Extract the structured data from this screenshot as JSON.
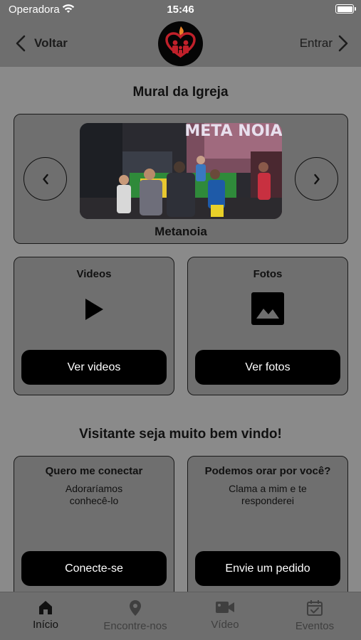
{
  "status_bar": {
    "carrier": "Operadora",
    "time": "15:46"
  },
  "nav": {
    "back_label": "Voltar",
    "login_label": "Entrar"
  },
  "mural": {
    "title": "Mural da Igreja",
    "caption": "Metanoia",
    "photo_banner_text": "META NOIA"
  },
  "videos_card": {
    "title": "Videos",
    "button": "Ver videos"
  },
  "photos_card": {
    "title": "Fotos",
    "button": "Ver fotos"
  },
  "welcome": {
    "title": "Visitante seja muito bem vindo!"
  },
  "connect_card": {
    "title": "Quero me conectar",
    "line1": "Adoraríamos",
    "line2": "conhecê-lo",
    "button": "Conecte-se"
  },
  "prayer_card": {
    "title": "Podemos orar por você?",
    "line1": "Clama a mim e te",
    "line2": "responderei",
    "button": "Envie um pedido"
  },
  "tabs": [
    {
      "label": "Início",
      "icon": "home-icon",
      "active": true
    },
    {
      "label": "Encontre-nos",
      "icon": "location-pin-icon",
      "active": false
    },
    {
      "label": "Vídeo",
      "icon": "video-camera-icon",
      "active": false
    },
    {
      "label": "Eventos",
      "icon": "calendar-check-icon",
      "active": false
    }
  ],
  "colors": {
    "background": "#8a8a8a",
    "bars": "#6e6e6e",
    "card": "#6f6f6f",
    "button": "#000000",
    "logo_heart": "#c0202a",
    "logo_flame": "#e8842a"
  }
}
